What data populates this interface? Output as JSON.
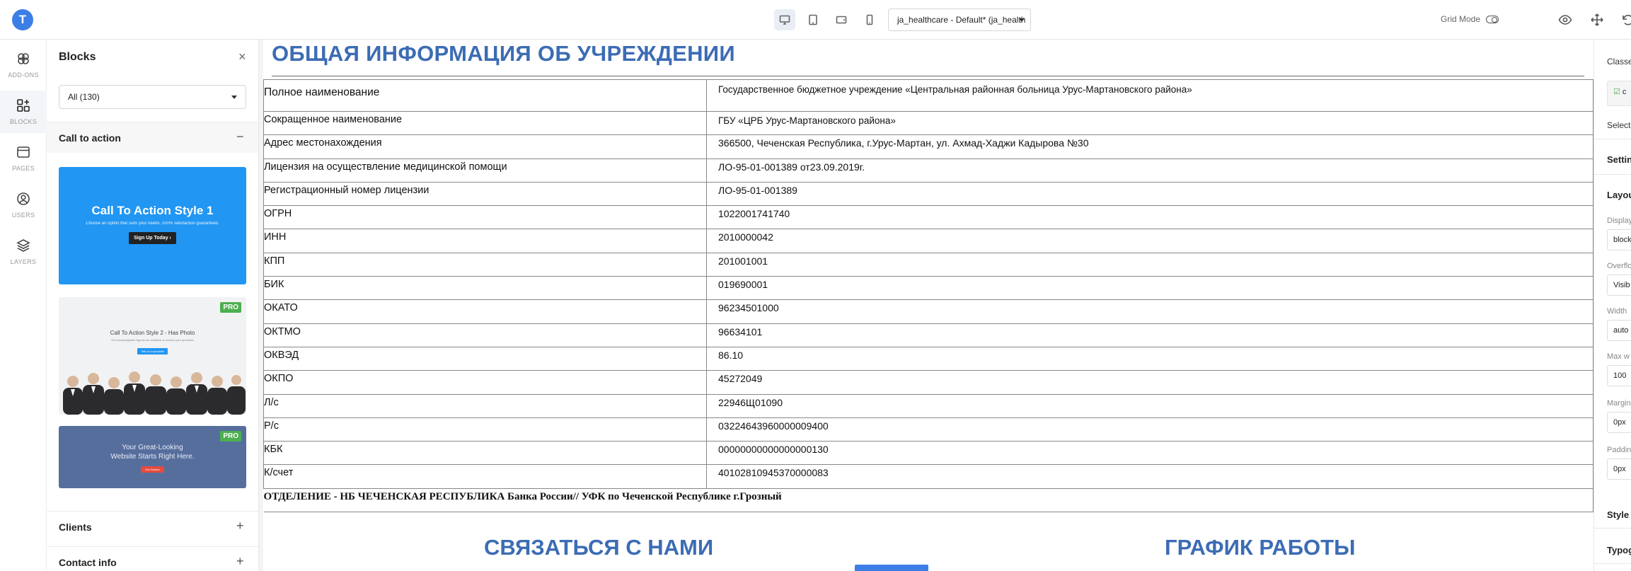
{
  "app": {
    "logo_letter": "T",
    "theme_select": "ja_healthcare - Default* (ja_health",
    "grid_mode_label": "Grid Mode"
  },
  "rail": {
    "items": [
      {
        "label": "ADD-ONS",
        "icon": "addons-icon"
      },
      {
        "label": "BLOCKS",
        "icon": "blocks-icon"
      },
      {
        "label": "PAGES",
        "icon": "pages-icon"
      },
      {
        "label": "USERS",
        "icon": "users-icon"
      },
      {
        "label": "LAYERS",
        "icon": "layers-icon"
      }
    ]
  },
  "blocks_panel": {
    "title": "Blocks",
    "close": "×",
    "filter_value": "All (130)",
    "sections": [
      {
        "title": "Call to action",
        "toggle": "−"
      },
      {
        "title": "Clients",
        "toggle": "+"
      },
      {
        "title": "Contact info",
        "toggle": "+"
      }
    ],
    "cards": [
      {
        "title": "Call To Action Style 1",
        "subtitle": "Choose an option that suits your needs. 100% satisfaction guaranteed.",
        "button": "Sign Up Today ›"
      },
      {
        "title": "Call To Action Style 2 - Has Photo",
        "subtitle": "The knowledgeable Agents are available to answer your questions",
        "button": "Talk to a specialist",
        "badge": "PRO"
      },
      {
        "title": "Your Great-Looking Website Starts Right Here.",
        "button": "Get Started",
        "badge": "PRO"
      }
    ]
  },
  "content": {
    "heading": "ОБЩАЯ ИНФОРМАЦИЯ ОБ УЧРЕЖДЕНИИ",
    "rows": [
      {
        "key": "Полное наименование",
        "value": "Государственное бюджетное учреждение «Центральная районная больница Урус-Мартановского района»"
      },
      {
        "key": "Сокращенное наименование",
        "value": "ГБУ «ЦРБ Урус-Мартановского района»"
      },
      {
        "key": "Адрес местонахождения",
        "value": "366500, Чеченская Республика, г.Урус-Мартан, ул. Ахмад-Хаджи Кадырова №30"
      },
      {
        "key": "Лицензия на осуществление медицинской помощи",
        "value": "ЛО-95-01-001389 от23.09.2019г."
      },
      {
        "key": "Регистрационный номер лицензии",
        "value": "ЛО-95-01-001389"
      },
      {
        "key": "ОГРН",
        "value": "1022001741740"
      },
      {
        "key": "ИНН",
        "value": "2010000042"
      },
      {
        "key": "КПП",
        "value": "201001001"
      },
      {
        "key": "БИК",
        "value": "019690001"
      },
      {
        "key": "ОКАТО",
        "value": "96234501000"
      },
      {
        "key": "ОКТМО",
        "value": "96634101"
      },
      {
        "key": "ОКВЭД",
        "value": "86.10"
      },
      {
        "key": "ОКПО",
        "value": "45272049"
      },
      {
        "key": "Л/с",
        "value": "22946Щ01090"
      },
      {
        "key": "Р/с",
        "value": "03224643960000009400"
      },
      {
        "key": "КБК",
        "value": "00000000000000000130"
      },
      {
        "key": "К/счет",
        "value": "40102810945370000083"
      }
    ],
    "bank_line": "ОТДЕЛЕНИЕ - НБ ЧЕЧЕНСКАЯ РЕСПУБЛИКА Банка России// УФК по Чеченской Республике г.Грозный",
    "contact_heading": "СВЯЗАТЬСЯ С НАМИ",
    "schedule_heading": "ГРАФИК РАБОТЫ"
  },
  "right_panel": {
    "classes_label": "Classe",
    "class_chip": "c",
    "selected_label": "Selecte",
    "settings_label": "Settin",
    "layout_label": "Layou",
    "display_label": "Display",
    "display_value": "block",
    "overflow_label": "Overflo",
    "overflow_value": "Visib",
    "width_label": "Width",
    "width_value": "auto",
    "max_width_label": "Max w",
    "max_width_value": "100",
    "margin_label": "Margin",
    "margin_value": "0px",
    "padding_label": "Paddin",
    "padding_value": "0px",
    "style_label": "Style",
    "typography_label": "Typog"
  }
}
